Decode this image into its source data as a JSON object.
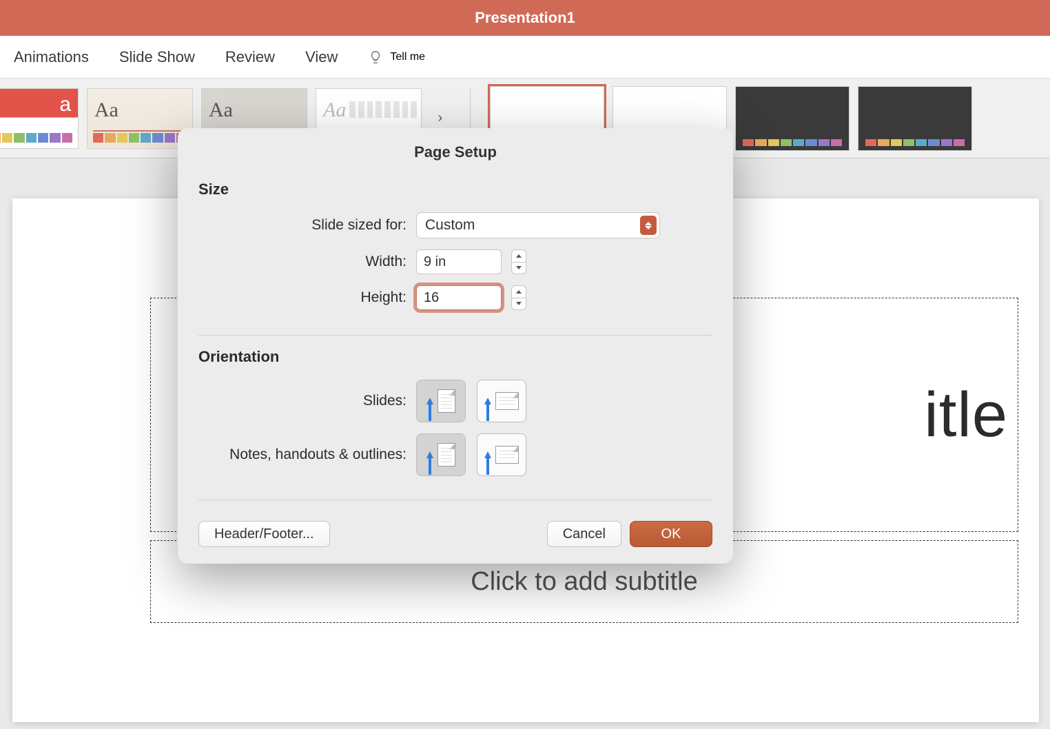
{
  "window": {
    "title": "Presentation1"
  },
  "ribbon": {
    "tabs": [
      "Animations",
      "Slide Show",
      "Review",
      "View"
    ],
    "tell_me": "Tell me"
  },
  "gallery": {
    "theme_aa": "Aa",
    "chevron": "›"
  },
  "slide": {
    "title_placeholder": "itle",
    "subtitle_placeholder": "Click to add subtitle"
  },
  "dialog": {
    "title": "Page Setup",
    "size": {
      "header": "Size",
      "sized_for_label": "Slide sized for:",
      "sized_for_value": "Custom",
      "width_label": "Width:",
      "width_value": "9 in",
      "height_label": "Height:",
      "height_value": "16"
    },
    "orientation": {
      "header": "Orientation",
      "slides_label": "Slides:",
      "notes_label": "Notes, handouts & outlines:"
    },
    "footer": {
      "header_footer": "Header/Footer...",
      "cancel": "Cancel",
      "ok": "OK"
    }
  }
}
